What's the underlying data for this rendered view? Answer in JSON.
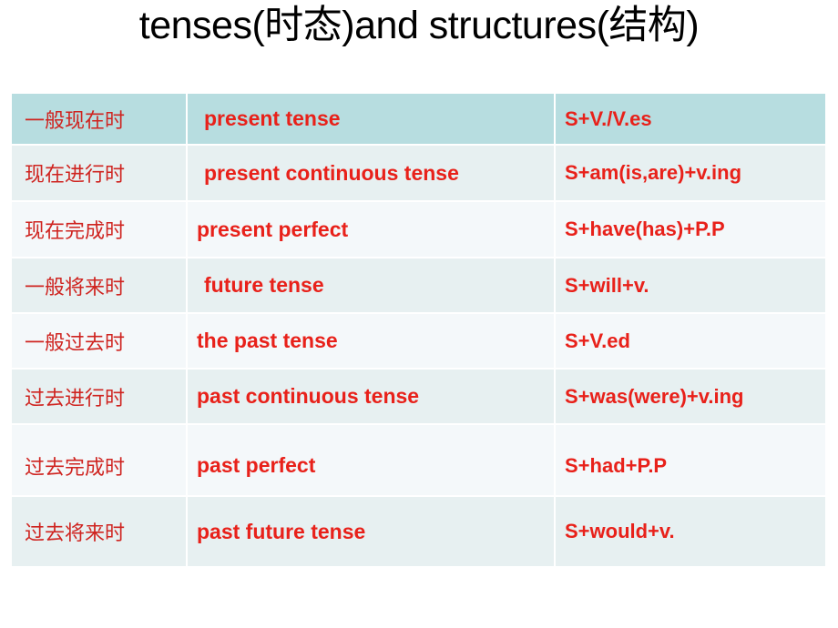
{
  "slide": {
    "title": "tenses(时态)and structures(结构)",
    "title_color": "#000000",
    "background": "#ffffff"
  },
  "table": {
    "accent_header_bg": "#b7dde0",
    "row_bg_a": "#e7f0f1",
    "row_bg_b": "#f4f8fa",
    "text_color": "#e8211a",
    "columns": 3,
    "rows": [
      {
        "chinese": "一般现在时",
        "english": "present tense",
        "structure": "S+V./V.es",
        "style": "head"
      },
      {
        "chinese": "现在进行时",
        "english": "present continuous tense",
        "structure": "S+am(is,are)+v.ing",
        "style": "a"
      },
      {
        "chinese": "现在完成时",
        "english": "present perfect",
        "structure": "S+have(has)+P.P",
        "style": "b"
      },
      {
        "chinese": "一般将来时",
        "english": "future tense",
        "structure": "S+will+v.",
        "style": "a"
      },
      {
        "chinese": "一般过去时",
        "english": "the past tense",
        "structure": "S+V.ed",
        "style": "b"
      },
      {
        "chinese": "过去进行时",
        "english": "past continuous tense",
        "structure": "S+was(were)+v.ing",
        "style": "a"
      },
      {
        "chinese": "过去完成时",
        "english": "past perfect",
        "structure": "S+had+P.P",
        "style": "b"
      },
      {
        "chinese": "过去将来时",
        "english": "past future tense",
        "structure": "S+would+v.",
        "style": "a"
      }
    ]
  }
}
